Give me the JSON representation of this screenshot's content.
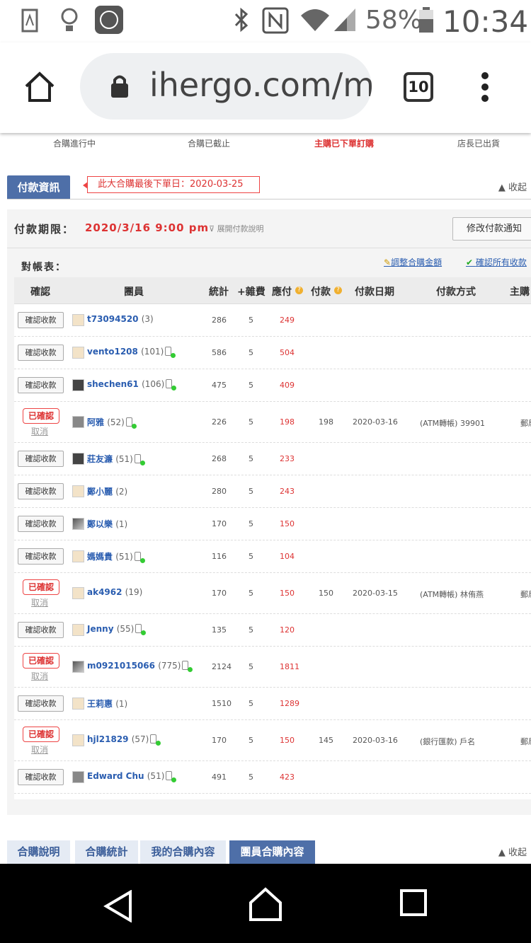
{
  "status_bar": {
    "battery": "58%",
    "time": "10:34"
  },
  "browser": {
    "url": "ihergo.com/m",
    "tab_count": "10"
  },
  "steps": [
    {
      "label": "合購進行中",
      "active": false
    },
    {
      "label": "合購已截止",
      "active": false
    },
    {
      "label": "主購已下單訂購",
      "active": true
    },
    {
      "label": "店長已出貨",
      "active": false
    }
  ],
  "payment": {
    "tab_label": "付款資訊",
    "last_order_note": "此大合購最後下單日：2020-03-25",
    "collapse_label": "收起",
    "deadline_label": "付款期限：",
    "deadline_value": "2020/3/16  9:00 pm",
    "expand_desc": "展開付款說明",
    "edit_button": "修改付款通知",
    "recon_label": "對帳表：",
    "adjust_link": "調整合購金額",
    "confirm_all_link": "確認所有收款"
  },
  "table": {
    "headers": [
      "確認",
      "團員",
      "統計",
      "+雜費",
      "應付",
      "付款",
      "付款日期",
      "付款方式",
      "主購"
    ],
    "confirm_btn": "確認收款",
    "confirmed_badge": "已確認",
    "cancel_link": "取消",
    "rows": [
      {
        "user": "t73094520",
        "count": "(3)",
        "phone": false,
        "total": "286",
        "fee": "5",
        "due": "249",
        "paid": "",
        "date": "",
        "method": "",
        "confirmed": false
      },
      {
        "user": "vento1208",
        "count": "(101)",
        "phone": true,
        "total": "586",
        "fee": "5",
        "due": "504",
        "paid": "",
        "date": "",
        "method": "",
        "confirmed": false
      },
      {
        "user": "shechen61",
        "count": "(106)",
        "phone": true,
        "total": "475",
        "fee": "5",
        "due": "409",
        "paid": "",
        "date": "",
        "method": "",
        "confirmed": false
      },
      {
        "user": "阿雅",
        "count": "(52)",
        "phone": true,
        "total": "226",
        "fee": "5",
        "due": "198",
        "paid": "198",
        "date": "2020-03-16",
        "method": "(ATM轉帳) 39901",
        "extra": "郵局",
        "confirmed": true
      },
      {
        "user": "莊友濂",
        "count": "(51)",
        "phone": true,
        "total": "268",
        "fee": "5",
        "due": "233",
        "paid": "",
        "date": "",
        "method": "",
        "confirmed": false
      },
      {
        "user": "鄭小麗",
        "count": "(2)",
        "phone": false,
        "total": "280",
        "fee": "5",
        "due": "243",
        "paid": "",
        "date": "",
        "method": "",
        "confirmed": false
      },
      {
        "user": "鄭以樂",
        "count": "(1)",
        "phone": false,
        "total": "170",
        "fee": "5",
        "due": "150",
        "paid": "",
        "date": "",
        "method": "",
        "confirmed": false
      },
      {
        "user": "媽媽貴",
        "count": "(51)",
        "phone": true,
        "total": "116",
        "fee": "5",
        "due": "104",
        "paid": "",
        "date": "",
        "method": "",
        "confirmed": false
      },
      {
        "user": "ak4962",
        "count": "(19)",
        "phone": false,
        "total": "170",
        "fee": "5",
        "due": "150",
        "paid": "150",
        "date": "2020-03-15",
        "method": "(ATM轉帳) 林侑燕",
        "extra": "郵局",
        "confirmed": true
      },
      {
        "user": "Jenny",
        "count": "(55)",
        "phone": true,
        "total": "135",
        "fee": "5",
        "due": "120",
        "paid": "",
        "date": "",
        "method": "",
        "confirmed": false
      },
      {
        "user": "m0921015066",
        "count": "(775)",
        "phone": true,
        "total": "2124",
        "fee": "5",
        "due": "1811",
        "paid": "",
        "date": "",
        "method": "",
        "confirmed": true
      },
      {
        "user": "王莉惠",
        "count": "(1)",
        "phone": false,
        "total": "1510",
        "fee": "5",
        "due": "1289",
        "paid": "",
        "date": "",
        "method": "",
        "confirmed": false
      },
      {
        "user": "hjl21829",
        "count": "(57)",
        "phone": true,
        "total": "170",
        "fee": "5",
        "due": "150",
        "paid": "145",
        "date": "2020-03-16",
        "method": "(銀行匯款) 戶名",
        "extra": "郵局",
        "confirmed": true
      },
      {
        "user": "Edward Chu",
        "count": "(51)",
        "phone": true,
        "total": "491",
        "fee": "5",
        "due": "423",
        "paid": "",
        "date": "",
        "method": "",
        "confirmed": false
      }
    ]
  },
  "bottom_tabs": [
    {
      "label": "合購說明",
      "active": false
    },
    {
      "label": "合購統計",
      "active": false
    },
    {
      "label": "我的合購內容",
      "active": false
    },
    {
      "label": "團員合購內容",
      "active": true
    }
  ],
  "bottom_collapse": "收起"
}
